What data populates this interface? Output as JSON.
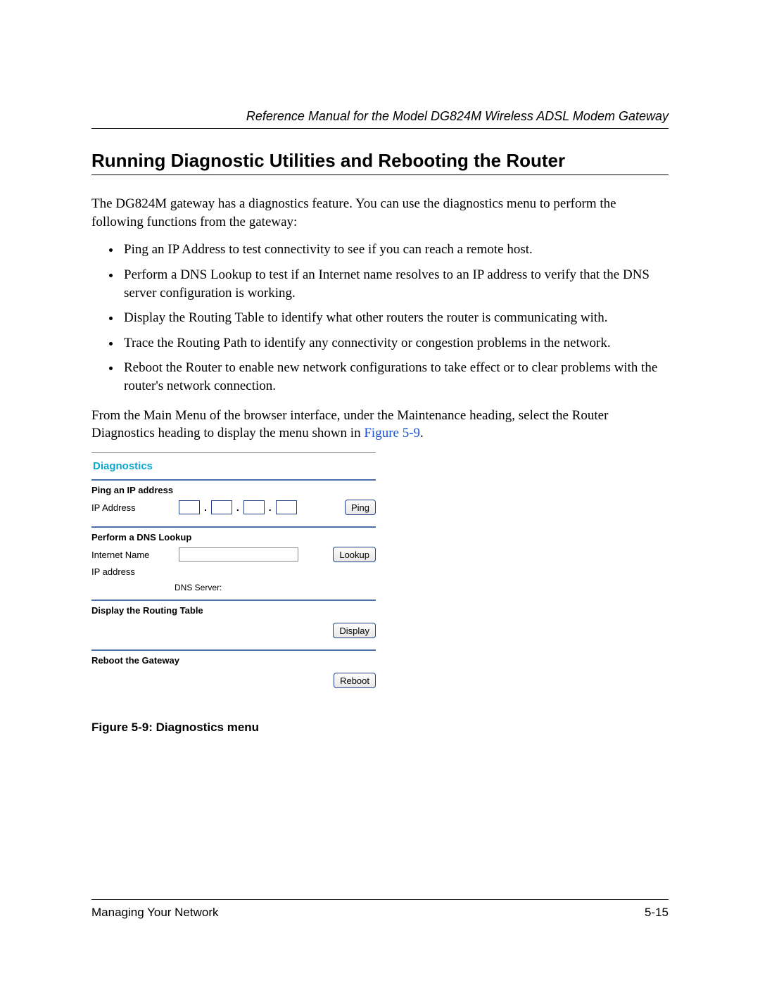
{
  "header": {
    "running_head": "Reference Manual for the Model DG824M Wireless ADSL Modem Gateway"
  },
  "section": {
    "title": "Running Diagnostic Utilities and Rebooting the Router",
    "intro": "The DG824M gateway has a diagnostics feature. You can use the diagnostics menu to perform the following functions from the gateway:",
    "bullets": [
      "Ping an IP Address to test connectivity to see if you can reach a remote host.",
      "Perform a DNS Lookup to test if an Internet name resolves to an IP address to verify that the DNS server configuration is working.",
      "Display the Routing Table to identify what other routers the router is communicating with.",
      "Trace the Routing Path to identify any connectivity or congestion problems in the network.",
      "Reboot the Router to enable new network configurations to take effect or to clear problems with the router's network connection."
    ],
    "after_list_a": "From the Main Menu of the browser interface, under the Maintenance heading, select the Router Diagnostics heading to display the menu shown in ",
    "xref": "Figure 5-9",
    "after_list_b": "."
  },
  "diag": {
    "title": "Diagnostics",
    "ping": {
      "heading": "Ping an IP address",
      "label": "IP Address",
      "button": "Ping"
    },
    "dns": {
      "heading": "Perform a DNS Lookup",
      "name_label": "Internet Name",
      "addr_label": "IP address",
      "server_label": "DNS Server:",
      "button": "Lookup"
    },
    "route": {
      "heading": "Display the Routing Table",
      "button": "Display"
    },
    "reboot": {
      "heading": "Reboot the Gateway",
      "button": "Reboot"
    }
  },
  "figure": {
    "caption": "Figure 5-9: Diagnostics menu"
  },
  "footer": {
    "left": "Managing Your Network",
    "right": "5-15"
  }
}
